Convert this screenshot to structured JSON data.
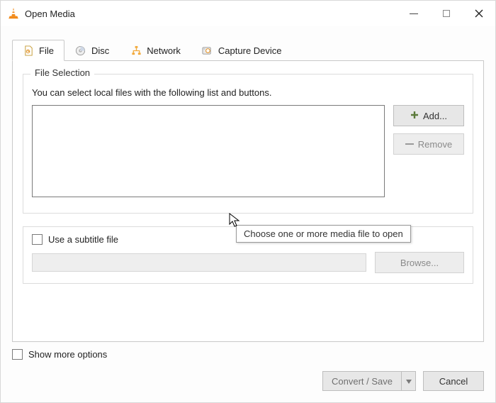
{
  "window": {
    "title": "Open Media"
  },
  "tabs": {
    "file": "File",
    "disc": "Disc",
    "network": "Network",
    "capture": "Capture Device"
  },
  "fileSelection": {
    "legend": "File Selection",
    "hint": "You can select local files with the following list and buttons.",
    "add": "Add...",
    "remove": "Remove",
    "tooltip": "Choose one or more media file to open"
  },
  "subtitle": {
    "checkbox_label": "Use a subtitle file",
    "browse": "Browse..."
  },
  "footer": {
    "show_more": "Show more options",
    "convert_save": "Convert / Save",
    "cancel": "Cancel"
  }
}
